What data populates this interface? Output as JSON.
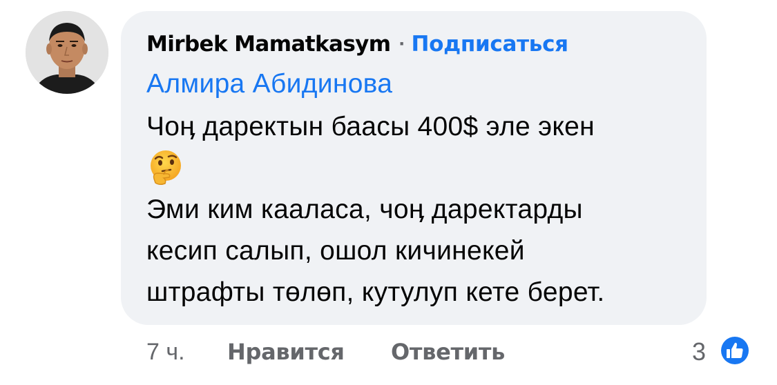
{
  "comment": {
    "author": "Mirbek Mamatkasym",
    "separator": "·",
    "subscribe_label": "Подписаться",
    "mention": "Алмира Абидинова",
    "lines": [
      "Чоӊ даректын баасы 400$ эле экен",
      "Эми ким кааласа, чоӊ даректарды",
      "кесип салып, ошол кичинекей",
      "штрафты төлөп, кутулуп кете берет."
    ],
    "emoji": "thinking-face"
  },
  "footer": {
    "time": "7 ч.",
    "like_label": "Нравится",
    "reply_label": "Ответить",
    "reaction_count": "3",
    "reaction_icon": "thumbs-up-icon"
  },
  "colors": {
    "link": "#1877f2",
    "text": "#050505",
    "muted": "#65676b",
    "bubble": "#f0f2f5"
  }
}
